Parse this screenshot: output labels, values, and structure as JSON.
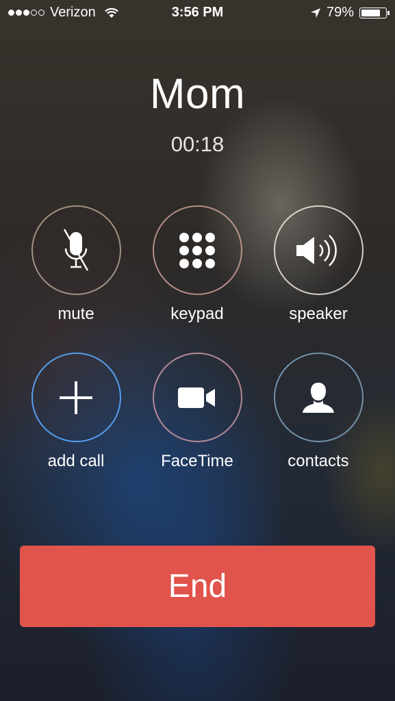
{
  "status_bar": {
    "signal_bars_filled": 3,
    "signal_bars_total": 5,
    "carrier": "Verizon",
    "time": "3:56 PM",
    "battery_percent_text": "79%",
    "battery_level": 0.79,
    "icons": [
      "wifi-icon",
      "location-arrow-icon",
      "battery-icon"
    ]
  },
  "call": {
    "caller_name": "Mom",
    "duration": "00:18"
  },
  "controls": [
    {
      "label": "mute",
      "icon": "muted-microphone-icon"
    },
    {
      "label": "keypad",
      "icon": "keypad-grid-icon"
    },
    {
      "label": "speaker",
      "icon": "speaker-icon"
    },
    {
      "label": "add call",
      "icon": "plus-icon"
    },
    {
      "label": "FaceTime",
      "icon": "video-camera-icon"
    },
    {
      "label": "contacts",
      "icon": "contact-silhouette-icon"
    }
  ],
  "end_button": {
    "label": "End",
    "color": "#e0544c"
  }
}
